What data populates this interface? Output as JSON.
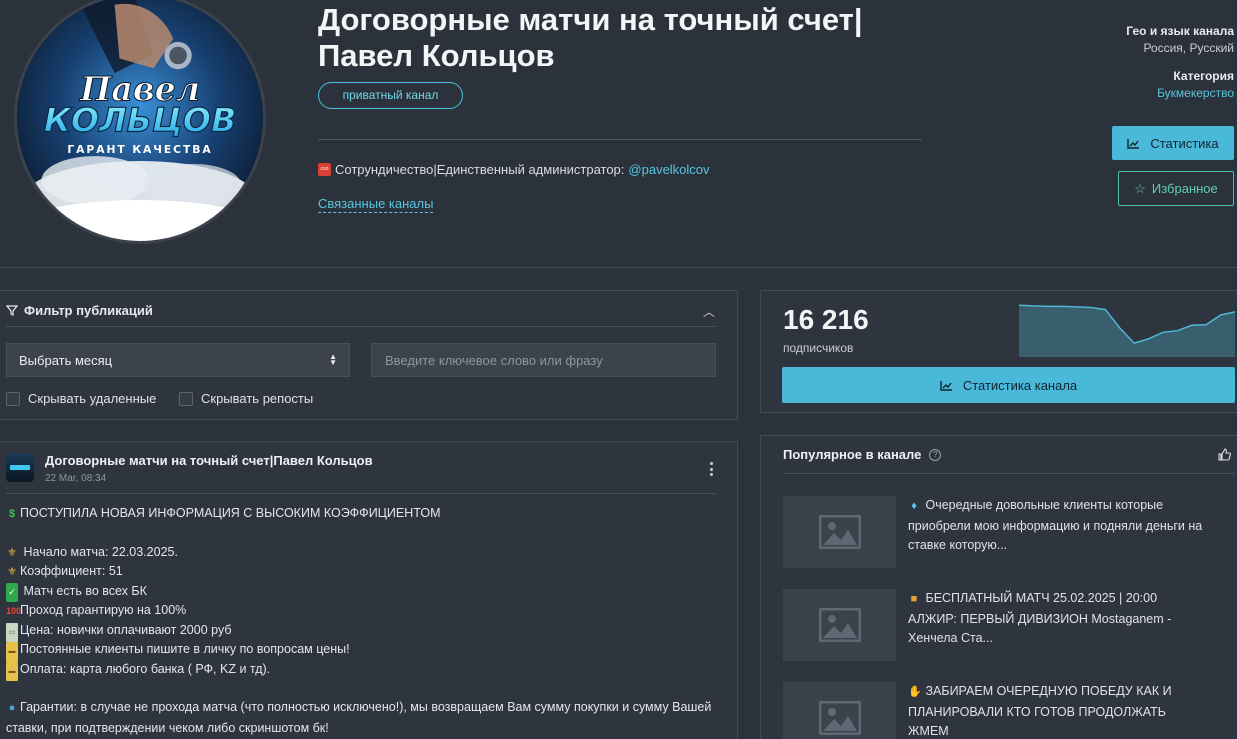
{
  "channel": {
    "title": "Договорные матчи на точный счет| Павел Кольцов",
    "badge": "приватный канал",
    "description": "Сотрундичество|Единственный администратор:",
    "admin_handle": "@pavelkolcov",
    "linked_channels": "Связанные каналы",
    "avatar_text": {
      "line1": "Павел",
      "line2": "КОЛЬЦОВ",
      "line3": "ГАРАНТ КАЧЕСТВА"
    }
  },
  "meta": {
    "geo_label": "Гео и язык канала",
    "geo_value": "Россия, Русский",
    "category_label": "Категория",
    "category_value": "Букмекерство"
  },
  "actions": {
    "stats_label": "Статистика",
    "favorite_label": "Избранное"
  },
  "filter": {
    "title": "Фильтр публикаций",
    "month_select": "Выбрать месяц",
    "keyword_placeholder": "Введите ключевое слово или фразу",
    "hide_deleted": "Скрывать удаленные",
    "hide_reposts": "Скрывать репосты"
  },
  "post": {
    "author": "Договорные матчи на точный счет|Павел Кольцов",
    "date": "22 Mar, 08:34",
    "lines": [
      "ПОСТУПИЛА НОВАЯ ИНФОРМАЦИЯ С ВЫСОКИМ КОЭФФИЦИЕНТОМ",
      "Начало матча: 22.03.2025.",
      "Коэффициент: 51",
      "Матч есть во всех БК",
      "Проход гарантирую на 100%",
      "Цена: новички оплачивают 2000 руб",
      "Постоянные клиенты пишите в личку по вопросам цены!",
      "Оплата: карта любого банка ( РФ, KZ и тд).",
      "Гарантии: в случае не прохода матча (что полностью исключено!), мы возвращаем Вам сумму покупки и сумму Вашей ставки, при подтверждении чеком либо скриншотом бк!"
    ]
  },
  "subscribers": {
    "count": "16 216",
    "label": "подписчиков",
    "button": "Статистика канала",
    "trend": [
      0.92,
      0.91,
      0.9,
      0.9,
      0.89,
      0.88,
      0.84,
      0.5,
      0.22,
      0.3,
      0.42,
      0.45,
      0.55,
      0.56,
      0.74,
      0.8
    ]
  },
  "popular": {
    "title": "Популярное в канале",
    "items": [
      {
        "text": "Очередные довольные клиенты которые приобрели мою информацию и подняли деньги на ставке которую..."
      },
      {
        "text": "БЕСПЛАТНЫЙ МАТЧ 25.02.2025 | 20:00 АЛЖИР: ПЕРВЫЙ ДИВИЗИОН Mostaganem - Хенчела Ста..."
      },
      {
        "text": "ЗАБИРАЕМ ОЧЕРЕДНУЮ ПОБЕДУ КАК И ПЛАНИРОВАЛИ КТО ГОТОВ ПРОДОЛЖАТЬ ЖМЕМ"
      }
    ]
  },
  "colors": {
    "background": "#2c323b",
    "panel": "#2f353e",
    "accent": "#4ab8d8",
    "link": "#57c6de",
    "favorite": "#4bbfa8"
  }
}
